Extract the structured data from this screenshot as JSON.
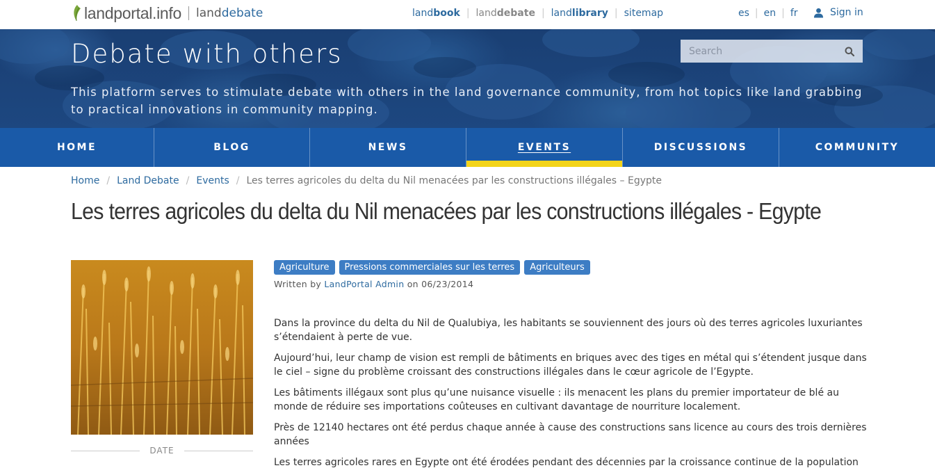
{
  "site": {
    "logo_text": "landportal.info",
    "logo_sub_prefix": "land",
    "logo_sub_suffix": "debate"
  },
  "topnav": {
    "items": [
      {
        "prefix": "land",
        "bold": "book"
      },
      {
        "prefix": "land",
        "bold": "debate"
      },
      {
        "prefix": "land",
        "bold": "library"
      },
      {
        "prefix": "",
        "bold": "sitemap"
      }
    ]
  },
  "langs": [
    "es",
    "en",
    "fr"
  ],
  "signin_label": "Sign in",
  "banner": {
    "title": "Debate with others",
    "description": "This platform serves to stimulate debate with others in the land governance community, from hot topics like land grabbing to practical innovations in community mapping.",
    "search_placeholder": "Search"
  },
  "mainnav": [
    "HOME",
    "BLOG",
    "NEWS",
    "EVENTS",
    "DISCUSSIONS",
    "COMMUNITY"
  ],
  "breadcrumb": {
    "items": [
      "Home",
      "Land Debate",
      "Events"
    ],
    "current": "Les terres agricoles du delta du Nil menacées par les constructions illégales – Egypte"
  },
  "article": {
    "title": "Les terres agricoles du delta du Nil menacées par les constructions illégales - Egypte",
    "tags": [
      "Agriculture",
      "Pressions commerciales sur les terres",
      "Agriculteurs"
    ],
    "byline_prefix": "Written by",
    "author": "LandPortal Admin",
    "byline_on": "on",
    "date": "06/23/2014",
    "date_label": "DATE",
    "paragraphs": [
      "Dans la province du delta du Nil de Qualubiya, les habitants se souviennent des jours où des terres agricoles luxuriantes s’étendaient à perte de vue.",
      "Aujourd’hui, leur champ de vision est rempli de bâtiments en briques avec des tiges en métal qui s’étendent jusque dans le ciel – signe du problème croissant des constructions illégales dans le cœur agricole de l’Egypte.",
      "Les bâtiments illégaux sont plus qu’une nuisance visuelle : ils menacent les plans du premier importateur de blé au monde de réduire ses importations coûteuses en cultivant davantage de nourriture localement.",
      "Près de 12140 hectares ont été perdus chaque année à cause des constructions sans licence au cours des trois dernières années",
      "Les terres agricoles rares en Egypte ont été érodées pendant des décennies par la croissance continue de la population et la"
    ]
  },
  "colors": {
    "link": "#2d6a9f",
    "nav_bg": "#1a5aa8",
    "active_bar": "#f3d41a",
    "tag_bg": "#3d7dc4"
  }
}
